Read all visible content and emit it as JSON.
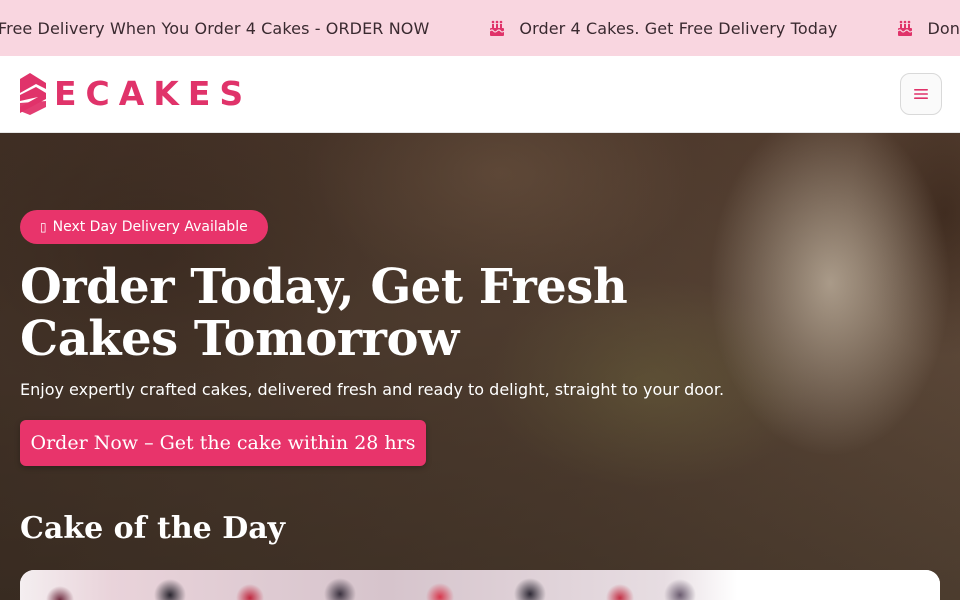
{
  "announcement": {
    "items": [
      {
        "text": "Free Delivery When You Order 4 Cakes - ORDER NOW",
        "icon": "birthday-cake-icon",
        "show_icon": false
      },
      {
        "text": "Order 4 Cakes. Get Free Delivery Today",
        "icon": "birthday-cake-icon",
        "show_icon": true
      },
      {
        "text": "Don’t W",
        "icon": "birthday-cake-icon",
        "show_icon": true
      }
    ]
  },
  "header": {
    "logo_text": "ECAKES",
    "menu_icon": "hamburger-menu-icon"
  },
  "hero": {
    "badge": "Next Day Delivery Available",
    "badge_icon": "▯",
    "title": "Order Today, Get Fresh Cakes Tomorrow",
    "subtitle": "Enjoy expertly crafted cakes, delivered fresh and ready to delight, straight to your door.",
    "cta": "Order Now – Get the cake within 28 hrs",
    "section_title": "Cake of the Day"
  },
  "colors": {
    "brand": "#e8346b",
    "announcement_bg": "#f9d6e0"
  }
}
